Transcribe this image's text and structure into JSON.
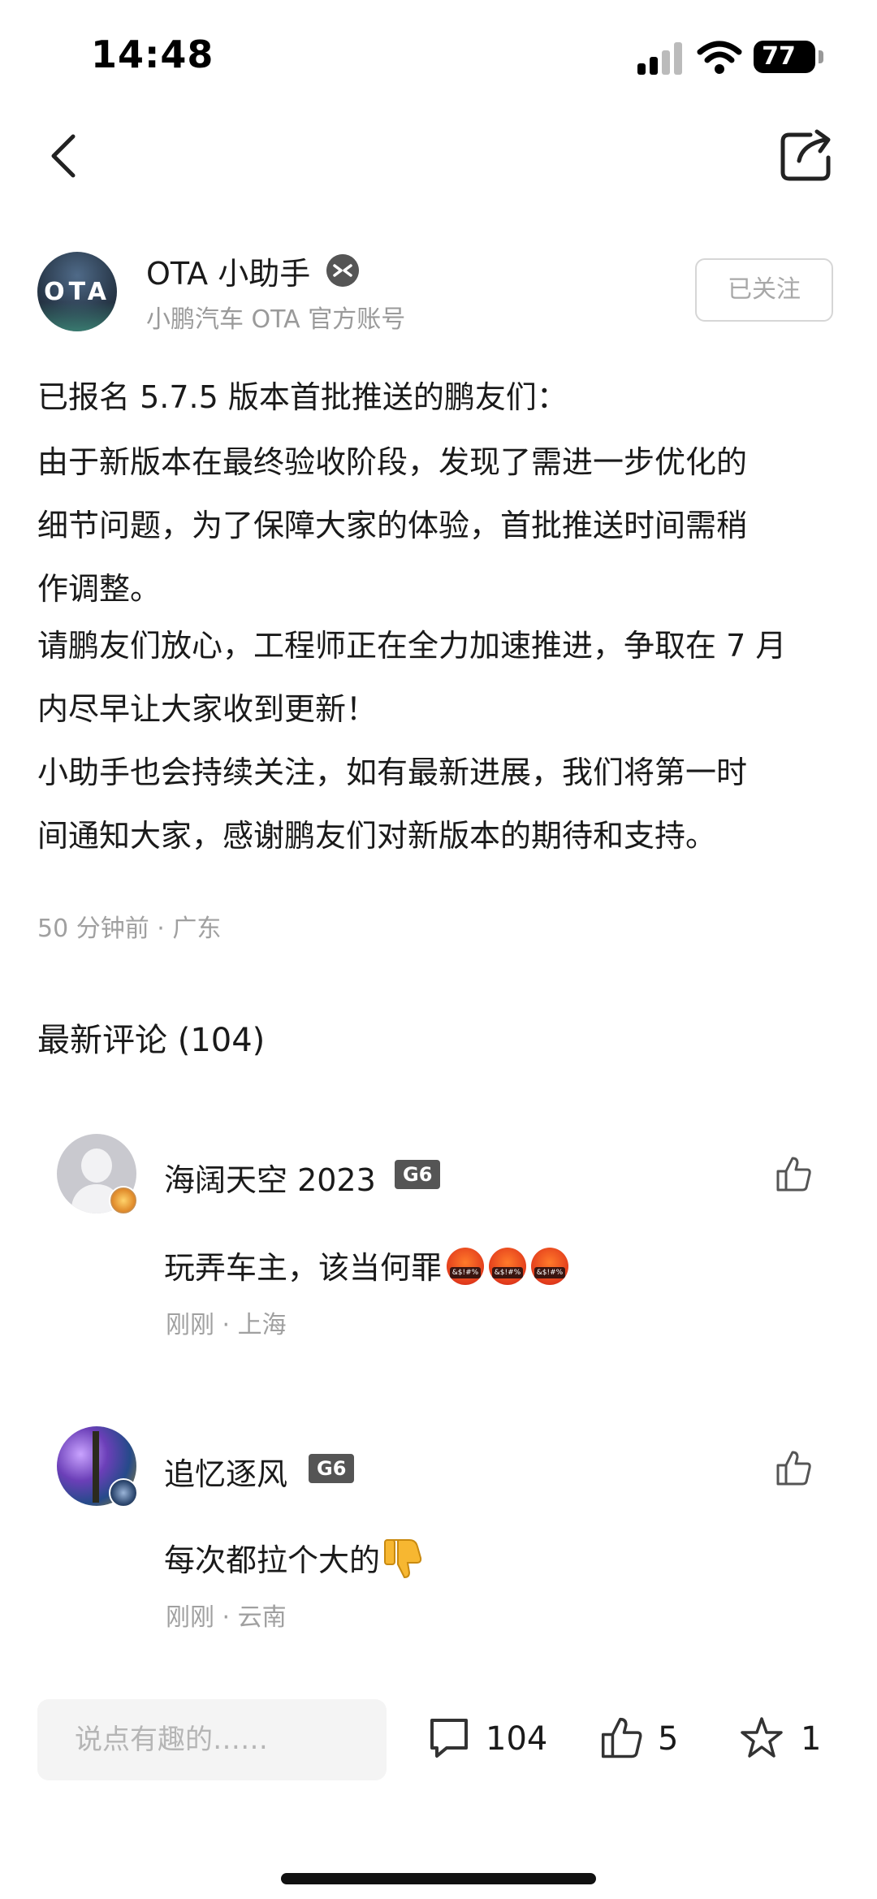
{
  "status_bar": {
    "time": "14:48",
    "battery": "77"
  },
  "author": {
    "avatar_text": "OTA",
    "name": "OTA 小助手",
    "subtitle": "小鹏汽车 OTA 官方账号",
    "follow_label": "已关注"
  },
  "post": {
    "lines": [
      "已报名 5.7.5 版本首批推送的鹏友们：",
      "由于新版本在最终验收阶段，发现了需进一步优化的",
      "细节问题，为了保障大家的体验，首批推送时间需稍",
      "作调整。",
      "请鹏友们放心，工程师正在全力加速推进，争取在 7 月",
      "内尽早让大家收到更新！",
      "小助手也会持续关注，如有最新进展，我们将第一时",
      "间通知大家，感谢鹏友们对新版本的期待和支持。"
    ],
    "meta": "50 分钟前 · 广东"
  },
  "comments_title": "最新评论 (104)",
  "comments": [
    {
      "name": "海阔天空 2023",
      "level": "G6",
      "text": "玩弄车主，该当何罪",
      "emoji": "angry-face-with-symbols x3",
      "meta": "刚刚 · 上海"
    },
    {
      "name": "追忆逐风",
      "level": "G6",
      "text": "每次都拉个大的",
      "emoji": "thumbs-down",
      "meta": "刚刚 · 云南"
    }
  ],
  "bottom_bar": {
    "input_placeholder": "说点有趣的……",
    "comment_count": "104",
    "like_count": "5",
    "star_count": "1"
  },
  "colors": {
    "text": "#1a1a1a",
    "muted": "#a0a0a0",
    "level_badge": "#555555",
    "input_bg": "#f4f4f4"
  }
}
